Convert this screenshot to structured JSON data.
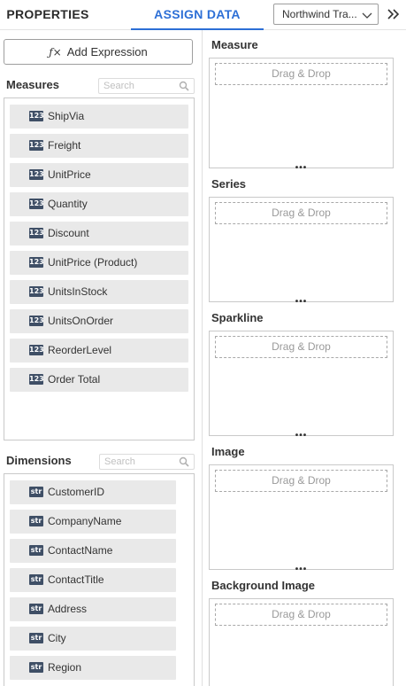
{
  "tabs": {
    "properties": "PROPERTIES",
    "assign_data": "ASSIGN DATA"
  },
  "datasource": {
    "selected": "Northwind Tra..."
  },
  "add_expression": {
    "icon": "fx-icon",
    "label": "Add Expression"
  },
  "measures": {
    "title": "Measures",
    "search_placeholder": "Search",
    "badge": "123",
    "items": [
      "ShipVia",
      "Freight",
      "UnitPrice",
      "Quantity",
      "Discount",
      "UnitPrice (Product)",
      "UnitsInStock",
      "UnitsOnOrder",
      "ReorderLevel",
      "Order Total"
    ]
  },
  "dimensions": {
    "title": "Dimensions",
    "search_placeholder": "Search",
    "badge": "str",
    "items": [
      "CustomerID",
      "CompanyName",
      "ContactName",
      "ContactTitle",
      "Address",
      "City",
      "Region"
    ]
  },
  "drop_targets": {
    "drop_text": "Drag & Drop",
    "sections": [
      {
        "title": "Measure"
      },
      {
        "title": "Series"
      },
      {
        "title": "Sparkline"
      },
      {
        "title": "Image"
      },
      {
        "title": "Background Image"
      }
    ]
  },
  "colors": {
    "accent": "#2d6fd6",
    "badge_bg": "#3f4f66",
    "field_bg": "#e9e9e9"
  }
}
